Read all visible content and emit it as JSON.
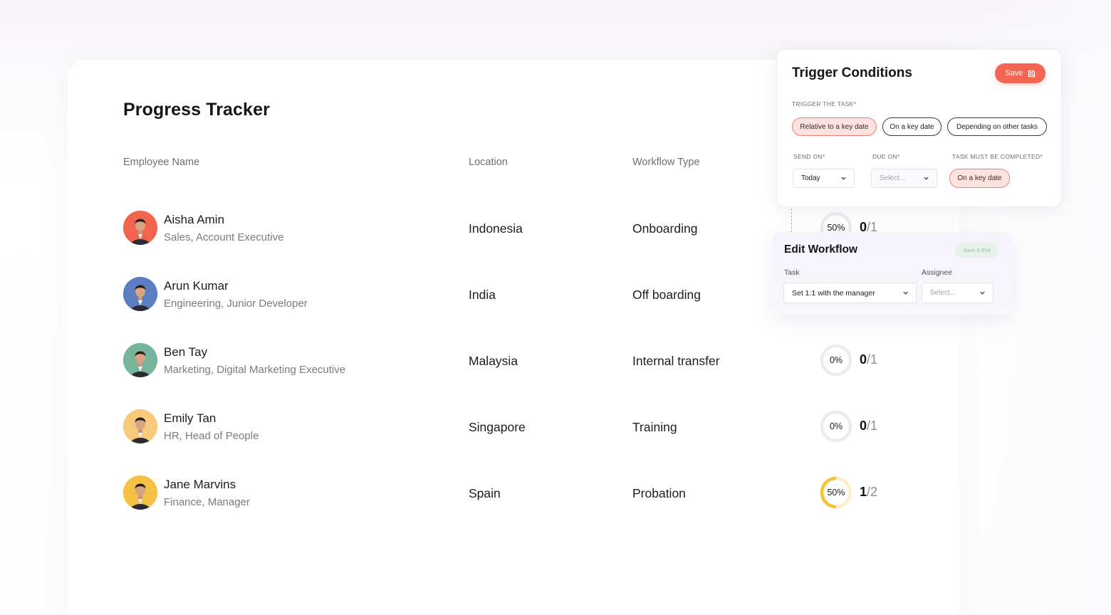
{
  "page_title": "Progress Tracker",
  "columns": {
    "employee": "Employee Name",
    "location": "Location",
    "workflow": "Workflow Type"
  },
  "rows": [
    {
      "name": "Aisha Amin",
      "role": "Sales, Account Executive",
      "location": "Indonesia",
      "workflow": "Onboarding",
      "percent_label": "50%",
      "progress": 0.5,
      "done": "0",
      "total": "1",
      "avatar_bg": "#f2654f",
      "ring_color": "#e9e9ec"
    },
    {
      "name": "Arun Kumar",
      "role": "Engineering, Junior Developer",
      "location": "India",
      "workflow": "Off boarding",
      "percent_label": "",
      "progress": 0,
      "done": "",
      "total": "",
      "avatar_bg": "#5b7ec2",
      "ring_color": "#e9e9ec"
    },
    {
      "name": "Ben Tay",
      "role": "Marketing, Digital Marketing Executive",
      "location": "Malaysia",
      "workflow": "Internal transfer",
      "percent_label": "0%",
      "progress": 0,
      "done": "0",
      "total": "1",
      "avatar_bg": "#76b59c",
      "ring_color": "#e9e9ec"
    },
    {
      "name": "Emily Tan",
      "role": "HR, Head of People",
      "location": "Singapore",
      "workflow": "Training",
      "percent_label": "0%",
      "progress": 0,
      "done": "0",
      "total": "1",
      "avatar_bg": "#f7c97a",
      "ring_color": "#e9e9ec"
    },
    {
      "name": "Jane Marvins",
      "role": "Finance, Manager",
      "location": "Spain",
      "workflow": "Probation",
      "percent_label": "50%",
      "progress": 0.5,
      "done": "1",
      "total": "2",
      "avatar_bg": "#f5c046",
      "ring_color": "#f5c338"
    }
  ],
  "trigger": {
    "title": "Trigger Conditions",
    "save_label": "Save",
    "trigger_label": "TRIGGER THE TASK*",
    "options": [
      "Relative to a key date",
      "On a key date",
      "Depending on other tasks"
    ],
    "send_on_label": "SEND ON*",
    "send_on_value": "Today",
    "due_on_label": "DUE ON*",
    "due_on_placeholder": "Select...",
    "complete_label": "TASK MUST BE COMPLETED*",
    "complete_value": "On a key date",
    "accent": "#f46651"
  },
  "edit": {
    "title": "Edit Workflow",
    "save_exit_label": "Save & Exit",
    "task_label": "Task",
    "task_value": "Set 1:1 with the manager",
    "assignee_label": "Assignee",
    "assignee_placeholder": "Select..."
  }
}
